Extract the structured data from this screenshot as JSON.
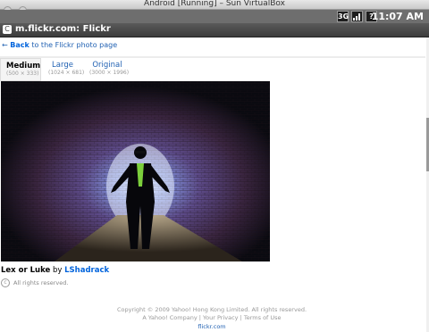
{
  "window": {
    "title": "Android [Running] – Sun VirtualBox"
  },
  "status_bar": {
    "time": "11:07 AM",
    "icons": [
      "3g-icon",
      "signal-icon",
      "battery-icon"
    ]
  },
  "browser": {
    "url_title": "m.flickr.com: Flickr"
  },
  "page": {
    "back_arrow": "←",
    "back_bold": "Back",
    "back_rest": "to the Flickr photo page",
    "sizes": [
      {
        "name": "Medium",
        "dims": "(500 × 333)",
        "active": true
      },
      {
        "name": "Large",
        "dims": "(1024 × 681)",
        "active": false
      },
      {
        "name": "Original",
        "dims": "(3000 × 1996)",
        "active": false
      }
    ],
    "photo": {
      "title": "Lex or Luke",
      "by": "by",
      "owner": "LShadrack"
    },
    "rights": "All rights reserved.",
    "cc_symbol": "c",
    "footer": {
      "copyright": "Copyright © 2009 Yahoo! Hong Kong Limited. All rights reserved.",
      "links": [
        "A Yahoo! Company",
        "Your Privacy",
        "Terms of Use"
      ],
      "separator": "|",
      "site": "flickr.com"
    }
  },
  "colors": {
    "link": "#0063dc",
    "statusbar": "#6e6e6e",
    "urlbar": "#4a4a4a"
  }
}
